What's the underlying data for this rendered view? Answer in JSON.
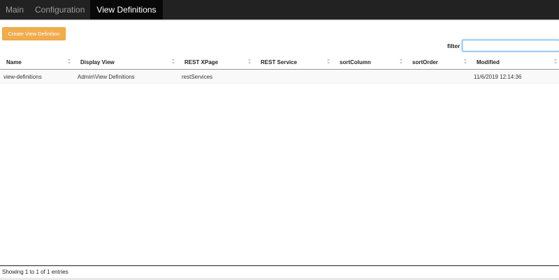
{
  "nav": {
    "tabs": [
      {
        "label": "Main",
        "active": false
      },
      {
        "label": "Configuration",
        "active": false
      },
      {
        "label": "View Definitions",
        "active": true
      }
    ]
  },
  "toolbar": {
    "create_label": "Create View Definition",
    "accent_color": "#f0ad4e"
  },
  "filter": {
    "label": "filter",
    "value": "",
    "placeholder": ""
  },
  "table": {
    "columns": [
      "Name",
      "Display View",
      "REST XPage",
      "REST Service",
      "sortColumn",
      "sortOrder",
      "Modified"
    ],
    "rows": [
      [
        "view-definitions",
        "Admin\\View Definitions",
        "restServices",
        "",
        "",
        "",
        "11/6/2019 12:14:36"
      ]
    ]
  },
  "footer": {
    "info": "Showing 1 to 1 of 1 entries"
  }
}
